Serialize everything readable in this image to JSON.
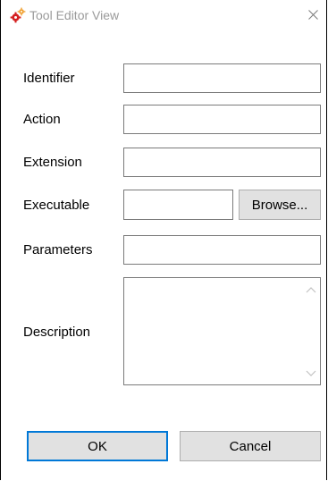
{
  "window": {
    "title": "Tool Editor View",
    "icon": "gears-icon",
    "close_icon": "close-icon"
  },
  "form": {
    "identifier": {
      "label": "Identifier",
      "value": ""
    },
    "action": {
      "label": "Action",
      "value": ""
    },
    "extension": {
      "label": "Extension",
      "value": ""
    },
    "executable": {
      "label": "Executable",
      "value": ""
    },
    "parameters": {
      "label": "Parameters",
      "value": ""
    },
    "description": {
      "label": "Description",
      "value": ""
    }
  },
  "buttons": {
    "browse": "Browse...",
    "ok": "OK",
    "cancel": "Cancel"
  },
  "colors": {
    "accent": "#0078d7",
    "icon_red": "#d42020",
    "icon_orange": "#f0a030",
    "title_text": "#9a9a9a",
    "button_face": "#e1e1e1"
  }
}
